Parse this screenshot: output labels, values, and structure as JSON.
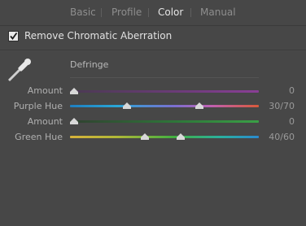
{
  "tabs": [
    {
      "label": "Basic",
      "active": false
    },
    {
      "label": "Profile",
      "active": false
    },
    {
      "label": "Color",
      "active": true
    },
    {
      "label": "Manual",
      "active": false
    }
  ],
  "chromatic": {
    "label": "Remove Chromatic Aberration",
    "checked": true
  },
  "defringe": {
    "title": "Defringe",
    "sliders": [
      {
        "label": "Amount",
        "value": "0"
      },
      {
        "label": "Purple Hue",
        "value": "30/70"
      },
      {
        "label": "Amount",
        "value": "0"
      },
      {
        "label": "Green Hue",
        "value": "40/60"
      }
    ]
  },
  "icons": {
    "eyedropper": "eyedropper-icon",
    "check": "check-icon"
  },
  "colors": {
    "panel": "#474747",
    "active_tab": "#e6e6e6"
  }
}
